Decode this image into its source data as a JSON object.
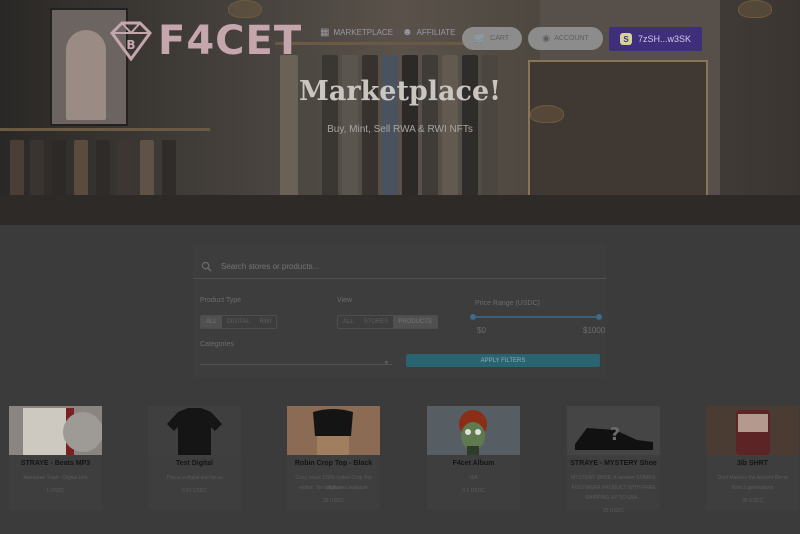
{
  "brand": {
    "name": "F4CET"
  },
  "nav": {
    "marketplace": "MARKETPLACE",
    "affiliate": "AFFILIATE",
    "cart": "CART",
    "account": "ACCOUNT",
    "wallet": "7zSH...w3SK"
  },
  "hero": {
    "title": "Marketplace!",
    "subtitle": "Buy, Mint, Sell RWA & RWI NFTs"
  },
  "filters": {
    "search_placeholder": "Search stores or products...",
    "product_type_label": "Product Type",
    "product_type_options": [
      "ALL",
      "DIGITAL",
      "RWI"
    ],
    "product_type_selected": "ALL",
    "view_label": "View",
    "view_options": [
      "ALL",
      "STORES",
      "PRODUCTS"
    ],
    "view_selected": "PRODUCTS",
    "price_range_label": "Price Range (USDC)",
    "price_min": "$0",
    "price_max": "$1000",
    "categories_label": "Categories",
    "apply_label": "APPLY FILTERS"
  },
  "products": [
    {
      "title": "STRAYE - Beats MP3",
      "desc": [
        "Awesome Track - Digital Link"
      ],
      "price": "1 USDC"
    },
    {
      "title": "Test Digital",
      "desc": [
        "This is a digital test for us"
      ],
      "price": "0.01 USDC"
    },
    {
      "title": "Robin Crop Top - Black",
      "desc": [
        "Cozy, black 100% cotton Crop Top Alpha",
        "edition. No duplicates available"
      ],
      "price": "25 USDC"
    },
    {
      "title": "F4cet Album",
      "desc": [
        "N/A"
      ],
      "price": "0.1 USDC"
    },
    {
      "title": "STRAYE - MYSTERY Shoe",
      "desc": [
        "MYSTERY SHOE! A random STRAYE",
        "FOOTWEAR PRODUCT WITH FREE",
        "SHIPPING UP TO USA..."
      ],
      "price": "25 USDC"
    },
    {
      "title": "3lb SHRT",
      "desc": [
        "Dorit Mantino the Ancient Blend",
        "from 3 generations"
      ],
      "price": "35 USDC"
    }
  ],
  "colors": {
    "wallet_bg": "#3f2f7a",
    "apply_bg": "#2a6470",
    "brand_pink": "#c6a6ad"
  }
}
